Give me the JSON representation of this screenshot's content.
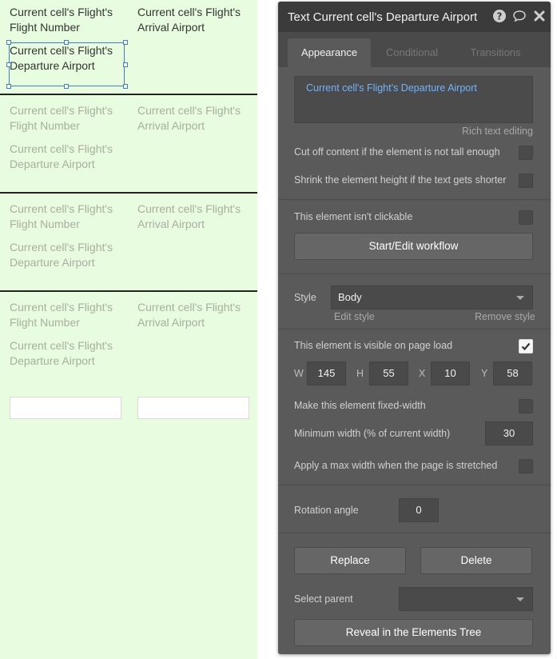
{
  "canvas": {
    "rows": [
      {
        "flight_number": "Current cell's Flight's Flight Number",
        "arrival_airport": "Current cell's Flight's Arrival Airport",
        "departure_airport": "Current cell's Flight's Departure Airport"
      },
      {
        "flight_number": "Current cell's Flight's Flight Number",
        "arrival_airport": "Current cell's Flight's Arrival Airport",
        "departure_airport": "Current cell's Flight's Departure Airport"
      },
      {
        "flight_number": "Current cell's Flight's Flight Number",
        "arrival_airport": "Current cell's Flight's Arrival Airport",
        "departure_airport": "Current cell's Flight's Departure Airport"
      },
      {
        "flight_number": "Current cell's Flight's Flight Number",
        "arrival_airport": "Current cell's Flight's Arrival Airport",
        "departure_airport": "Current cell's Flight's Departure Airport"
      }
    ]
  },
  "panel": {
    "title": "Text Current cell's Departure Airport",
    "icons": {
      "help": "help-icon",
      "comment": "comment-icon",
      "close": "close-icon"
    },
    "tabs": [
      "Appearance",
      "Conditional",
      "Transitions"
    ],
    "active_tab": "Appearance",
    "text_content": "Current cell's Flight's Departure Airport",
    "rich_text_label": "Rich text editing",
    "cut_off_label": "Cut off content if the element is not tall enough",
    "shrink_label": "Shrink the element height if the text gets shorter",
    "not_clickable_label": "This element isn't clickable",
    "workflow_button": "Start/Edit workflow",
    "style_label": "Style",
    "style_value": "Body",
    "edit_style": "Edit style",
    "remove_style": "Remove style",
    "visible_label": "This element is visible on page load",
    "visible_checked": true,
    "geometry_fields": [
      {
        "label": "W",
        "value": "145"
      },
      {
        "label": "H",
        "value": "55"
      },
      {
        "label": "X",
        "value": "10"
      },
      {
        "label": "Y",
        "value": "58"
      }
    ],
    "fixed_width_label": "Make this element fixed-width",
    "min_width_label": "Minimum width (% of current width)",
    "min_width_value": "30",
    "max_width_label": "Apply a max width when the page is stretched",
    "rotation_label": "Rotation angle",
    "rotation_value": "0",
    "replace_button": "Replace",
    "delete_button": "Delete",
    "select_parent_label": "Select parent",
    "select_parent_value": "",
    "reveal_button": "Reveal in the Elements Tree"
  },
  "colors": {
    "canvas_bg": "#e8fddf",
    "panel_bg": "#5a5a5a",
    "header_bg": "#3b3b3b",
    "accent_text": "#6eb4ff",
    "selection": "#3d7dd6"
  }
}
